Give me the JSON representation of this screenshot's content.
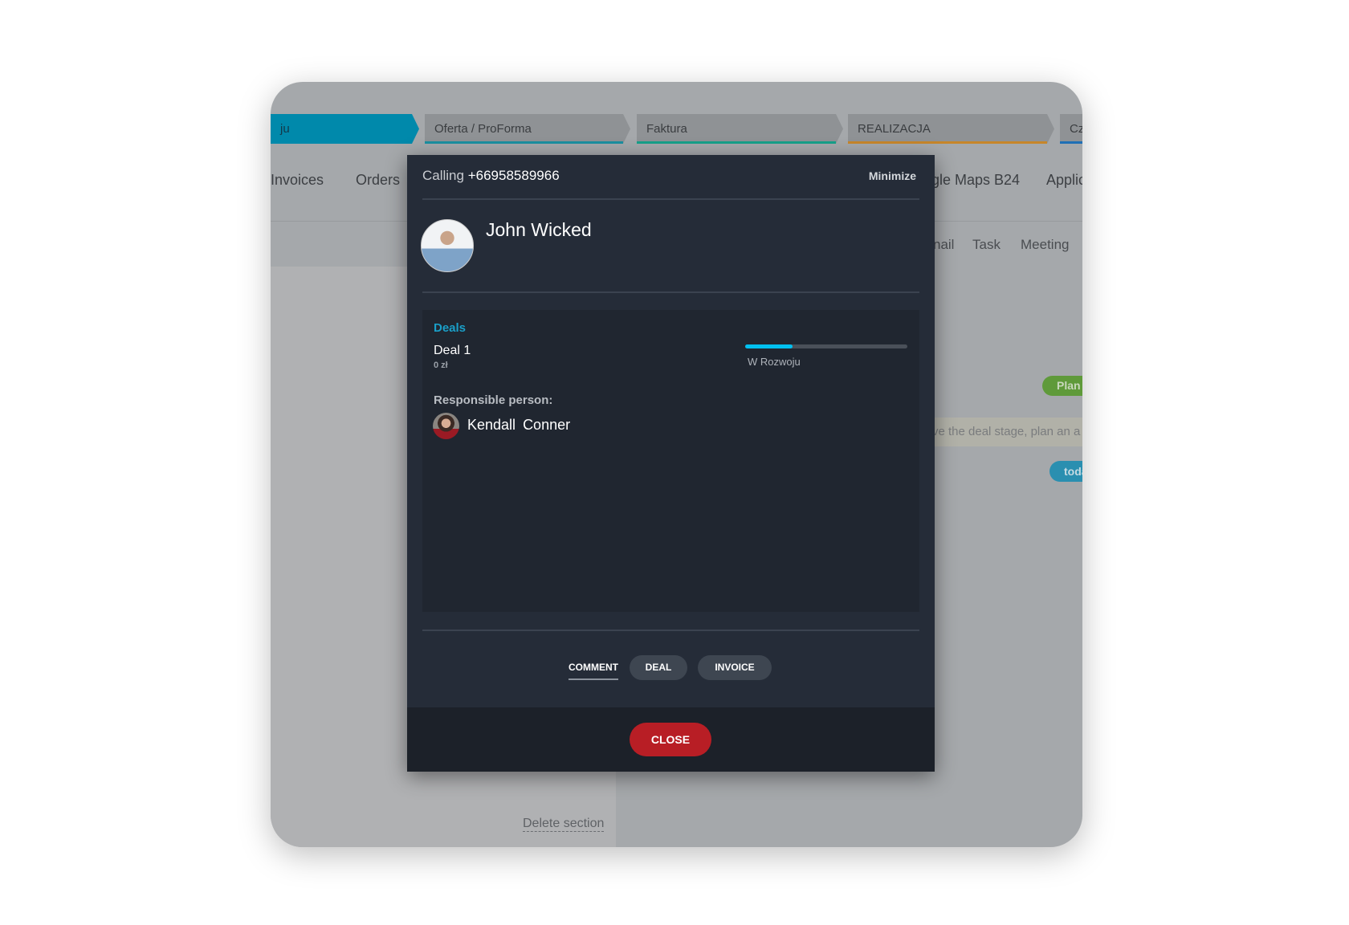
{
  "background": {
    "stages": [
      {
        "label": "ju",
        "color": "#0089ab"
      },
      {
        "label": "Oferta / ProForma",
        "color": "#1a8fa0"
      },
      {
        "label": "Faktura",
        "color": "#16a08a"
      },
      {
        "label": "REALIZACJA",
        "color": "#c7862a"
      },
      {
        "label": "Cz",
        "color": "#1f6fb5"
      }
    ],
    "nav": [
      "Invoices",
      "Orders",
      "gle Maps B24",
      "Applic"
    ],
    "tabs": [
      "nail",
      "Task",
      "Meeting"
    ],
    "plan_badge": "Plan",
    "note": "ve the deal stage, plan an a",
    "today_badge": "toda",
    "delete_section": "Delete section"
  },
  "modal": {
    "calling_label": "Calling",
    "phone": "+66958589966",
    "minimize": "Minimize",
    "contact_name": "John Wicked",
    "deals_title": "Deals",
    "deal_name": "Deal 1",
    "deal_amount": "0 zł",
    "stage_label": "W Rozwoju",
    "stage_progress": 0.29,
    "responsible_label": "Responsible person:",
    "responsible_first": "Kendall",
    "responsible_last": "Conner",
    "actions": [
      "COMMENT",
      "DEAL",
      "INVOICE"
    ],
    "close": "CLOSE",
    "colors": {
      "accent": "#1a9fc8",
      "progress": "#00c0f0",
      "close": "#b81e25"
    }
  }
}
